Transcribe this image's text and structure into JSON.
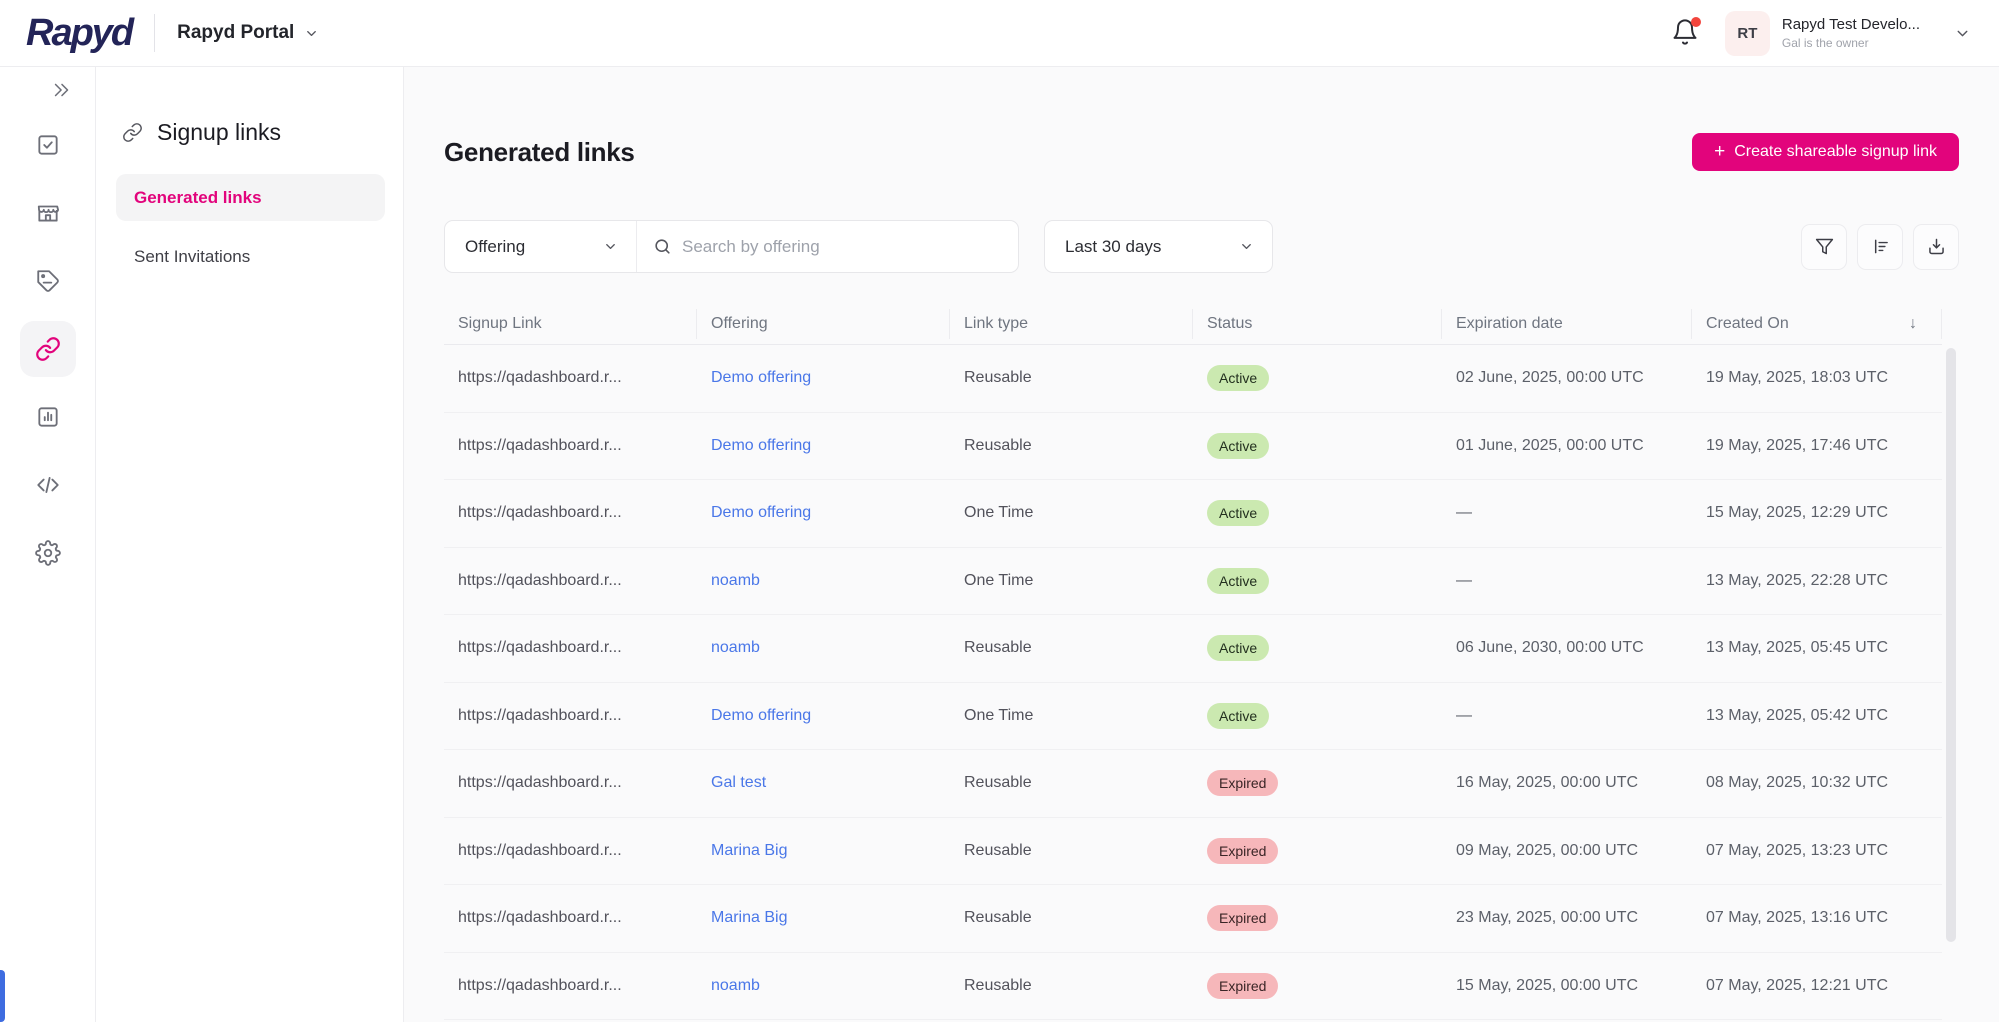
{
  "header": {
    "logo_text": "Rapyd",
    "portal_selector": "Rapyd Portal",
    "notifications": {
      "icon": "bell-icon",
      "unread_dot": true
    },
    "account": {
      "initials": "RT",
      "name": "Rapyd Test Develo...",
      "subtitle": "Gal is the owner"
    }
  },
  "icon_rail": {
    "expand_icon": "double-chevron-right",
    "items": [
      {
        "icon": "check-square",
        "active": false
      },
      {
        "icon": "storefront",
        "active": false
      },
      {
        "icon": "tag",
        "active": false
      },
      {
        "icon": "link",
        "active": true
      },
      {
        "icon": "bar-chart",
        "active": false
      },
      {
        "icon": "code",
        "active": false
      },
      {
        "icon": "gear",
        "active": false
      }
    ]
  },
  "sidebar": {
    "title": "Signup links",
    "title_icon": "link-icon",
    "items": [
      {
        "label": "Generated links",
        "active": true
      },
      {
        "label": "Sent Invitations",
        "active": false
      }
    ]
  },
  "main": {
    "title": "Generated links",
    "create_button": {
      "icon": "+",
      "label": "Create shareable signup link"
    },
    "filters": {
      "offering_label": "Offering",
      "search_placeholder": "Search by offering",
      "search_value": "",
      "date_range": "Last 30 days",
      "action_icons": [
        "filter-icon",
        "sort-icon",
        "download-icon"
      ]
    },
    "table": {
      "columns": [
        "Signup Link",
        "Offering",
        "Link type",
        "Status",
        "Expiration date",
        "Created On"
      ],
      "sorted_column": "Created On",
      "sort_direction": "desc",
      "sort_arrow": "↓",
      "rows": [
        {
          "url": "https://qadashboard.r...",
          "offering": "Demo offering",
          "link_type": "Reusable",
          "status": "Active",
          "expiration": "02 June, 2025, 00:00 UTC",
          "created": "19 May, 2025, 18:03 UTC"
        },
        {
          "url": "https://qadashboard.r...",
          "offering": "Demo offering",
          "link_type": "Reusable",
          "status": "Active",
          "expiration": "01 June, 2025, 00:00 UTC",
          "created": "19 May, 2025, 17:46 UTC"
        },
        {
          "url": "https://qadashboard.r...",
          "offering": "Demo offering",
          "link_type": "One Time",
          "status": "Active",
          "expiration": "—",
          "created": "15 May, 2025, 12:29 UTC"
        },
        {
          "url": "https://qadashboard.r...",
          "offering": "noamb",
          "link_type": "One Time",
          "status": "Active",
          "expiration": "—",
          "created": "13 May, 2025, 22:28 UTC"
        },
        {
          "url": "https://qadashboard.r...",
          "offering": "noamb",
          "link_type": "Reusable",
          "status": "Active",
          "expiration": "06 June, 2030, 00:00 UTC",
          "created": "13 May, 2025, 05:45 UTC"
        },
        {
          "url": "https://qadashboard.r...",
          "offering": "Demo offering",
          "link_type": "One Time",
          "status": "Active",
          "expiration": "—",
          "created": "13 May, 2025, 05:42 UTC"
        },
        {
          "url": "https://qadashboard.r...",
          "offering": "Gal test",
          "link_type": "Reusable",
          "status": "Expired",
          "expiration": "16 May, 2025, 00:00 UTC",
          "created": "08 May, 2025, 10:32 UTC"
        },
        {
          "url": "https://qadashboard.r...",
          "offering": "Marina Big",
          "link_type": "Reusable",
          "status": "Expired",
          "expiration": "09 May, 2025, 00:00 UTC",
          "created": "07 May, 2025, 13:23 UTC"
        },
        {
          "url": "https://qadashboard.r...",
          "offering": "Marina Big",
          "link_type": "Reusable",
          "status": "Expired",
          "expiration": "23 May, 2025, 00:00 UTC",
          "created": "07 May, 2025, 13:16 UTC"
        },
        {
          "url": "https://qadashboard.r...",
          "offering": "noamb",
          "link_type": "Reusable",
          "status": "Expired",
          "expiration": "15 May, 2025, 00:00 UTC",
          "created": "07 May, 2025, 12:21 UTC"
        }
      ]
    }
  },
  "colors": {
    "accent_pink": "#E2047C",
    "logo_navy": "#232458",
    "link_blue": "#4A77E8",
    "badge_active_bg": "#CBE9B0",
    "badge_expired_bg": "#F6B7BA",
    "notification_red": "#F2453D",
    "edge_widget_blue": "#3E6CE0"
  }
}
